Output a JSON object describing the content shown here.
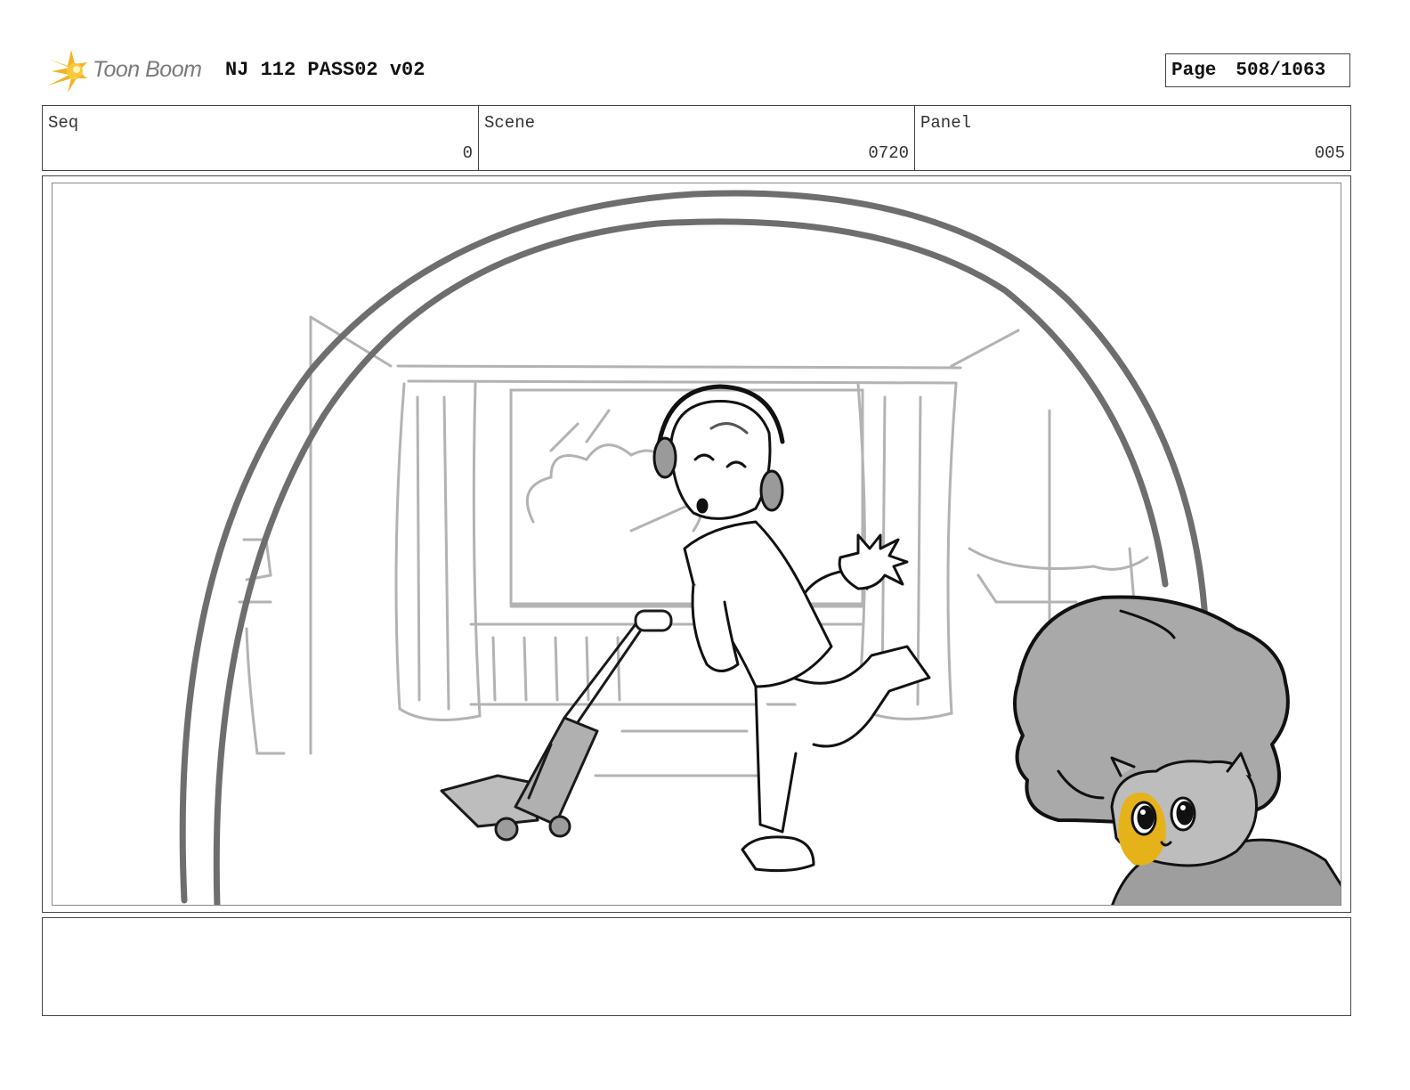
{
  "header": {
    "logo_text": "Toon Boom",
    "project_title": "NJ 112 PASS02 v02",
    "page_label": "Page",
    "page_value": "508/1063"
  },
  "info": {
    "seq_label": "Seq",
    "seq_value": "0",
    "scene_label": "Scene",
    "scene_value": "0720",
    "panel_label": "Panel",
    "panel_value": "005"
  },
  "colors": {
    "logo_orange": "#f5b323",
    "sketch_gray": "#b3b3b3",
    "fill_gray": "#a9a9a9",
    "accent_yellow": "#e5b21a"
  },
  "caption": {
    "text": ""
  }
}
